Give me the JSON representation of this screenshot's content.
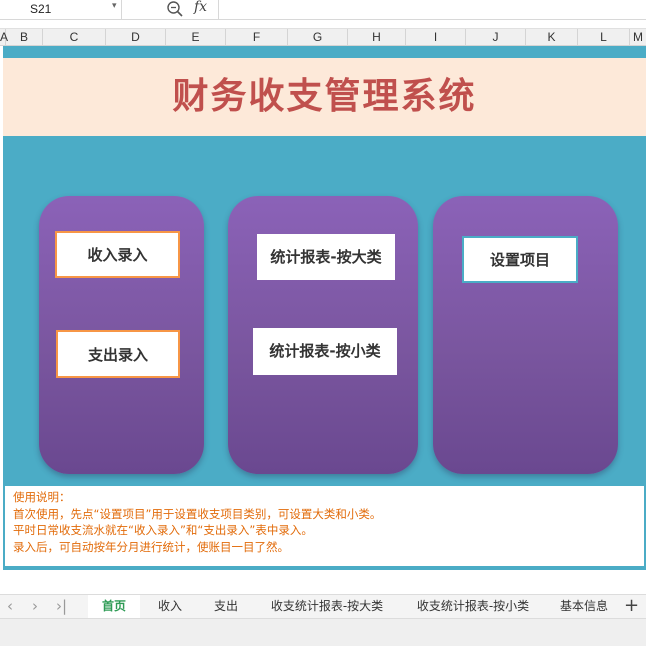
{
  "formula_bar": {
    "cell_ref": "S21",
    "zoom_icon": "zoom-icon",
    "fx_label": "fx"
  },
  "columns": [
    "A",
    "B",
    "C",
    "D",
    "E",
    "F",
    "G",
    "H",
    "I",
    "J",
    "K",
    "L",
    "M"
  ],
  "title": "财务收支管理系统",
  "buttons": {
    "income": "收入录入",
    "expense": "支出录入",
    "report_major": "统计报表-按大类",
    "report_minor": "统计报表-按小类",
    "settings": "设置项目"
  },
  "notes": {
    "heading": "使用说明：",
    "line1": "首次使用，先点“设置项目”用于设置收支项目类别，可设置大类和小类。",
    "line2": "平时日常收支流水就在“收入录入”和“支出录入”表中录入。",
    "line3": "录入后，可自动按年分月进行统计，使账目一目了然。"
  },
  "sheet_tabs": [
    "首页",
    "收入",
    "支出",
    "收支统计报表-按大类",
    "收支统计报表-按小类",
    "基本信息"
  ],
  "nav_icons": {
    "first": "‹",
    "prev": "›",
    "last": "›|"
  },
  "add_tab": "+",
  "colors": {
    "title": "#c0504d",
    "title_band": "#fde9d9",
    "teal": "#4bacc6",
    "panel": "#7a569f",
    "notes_text": "#e26b0a",
    "active_tab": "#2e9b55"
  }
}
